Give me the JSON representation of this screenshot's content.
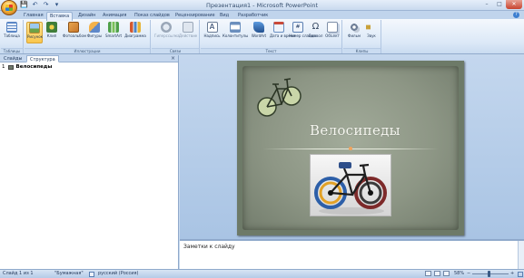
{
  "window": {
    "title": "Презентация1 - Microsoft PowerPoint",
    "controls": [
      "–",
      "□",
      "✕"
    ]
  },
  "qat": [
    "💾",
    "↶",
    "↷",
    "▾"
  ],
  "tabs": [
    {
      "label": "Главная",
      "active": false
    },
    {
      "label": "Вставка",
      "active": true
    },
    {
      "label": "Дизайн",
      "active": false
    },
    {
      "label": "Анимация",
      "active": false
    },
    {
      "label": "Показ слайдов",
      "active": false
    },
    {
      "label": "Рецензирование",
      "active": false
    },
    {
      "label": "Вид",
      "active": false
    },
    {
      "label": "Разработчик",
      "active": false
    }
  ],
  "ribbon": {
    "groups": [
      {
        "label": "Таблицы",
        "buttons": [
          {
            "label": "Таблица",
            "icon": "table-icon",
            "color": "#5b87c5"
          }
        ]
      },
      {
        "label": "Иллюстрации",
        "buttons": [
          {
            "label": "Рисунок",
            "icon": "picture-icon",
            "color": "#e0b44a",
            "selected": true
          },
          {
            "label": "Клип",
            "icon": "clipart-icon",
            "color": "#3f7e3a"
          },
          {
            "label": "Фотоальбом",
            "icon": "photo-album-icon",
            "color": "#c8772b"
          },
          {
            "label": "Фигуры",
            "icon": "shapes-icon",
            "color": "#5f88c9"
          },
          {
            "label": "SmartArt",
            "icon": "smartart-icon",
            "color": "#4fa04a"
          },
          {
            "label": "Диаграмма",
            "icon": "chart-icon",
            "color": "#d4582e"
          }
        ]
      },
      {
        "label": "Связи",
        "buttons": [
          {
            "label": "Гиперссылка",
            "icon": "hyperlink-icon",
            "color": "#9aa7b8",
            "dim": true
          },
          {
            "label": "Действие",
            "icon": "action-icon",
            "color": "#9aa7b8",
            "dim": true
          }
        ]
      },
      {
        "label": "Текст",
        "buttons": [
          {
            "label": "Надпись",
            "icon": "textbox-icon",
            "color": "#6a7c95"
          },
          {
            "label": "Колонтитулы",
            "icon": "header-footer-icon",
            "color": "#6b8fbe"
          },
          {
            "label": "WordArt",
            "icon": "wordart-icon",
            "color": "#3e6fb6"
          },
          {
            "label": "Дата и время",
            "icon": "datetime-icon",
            "color": "#6a8fc2"
          },
          {
            "label": "Номер слайда",
            "icon": "slide-number-icon",
            "color": "#5b7fb2"
          },
          {
            "label": "Символ",
            "icon": "symbol-icon",
            "color": "#5f6f85"
          },
          {
            "label": "Объект",
            "icon": "object-icon",
            "color": "#7d8ea8"
          }
        ]
      },
      {
        "label": "Клипы мультимедиа",
        "buttons": [
          {
            "label": "Фильм",
            "icon": "movie-icon",
            "color": "#6f7f97"
          },
          {
            "label": "Звук",
            "icon": "sound-icon",
            "color": "#c9a13a"
          }
        ]
      }
    ]
  },
  "leftpane": {
    "tabs": [
      {
        "label": "Слайды",
        "active": false
      },
      {
        "label": "Структура",
        "active": true
      }
    ],
    "close": "×",
    "outline": [
      {
        "number": "1",
        "text": "Велосипеды"
      }
    ]
  },
  "slide": {
    "title": "Велосипеды"
  },
  "notes": {
    "placeholder": "Заметки к слайду"
  },
  "status": {
    "slide": "Слайд 1 из 1",
    "theme": "\"Бумажная\"",
    "language": "русский (Россия)",
    "zoom": "58%",
    "zoom_value": 58
  }
}
